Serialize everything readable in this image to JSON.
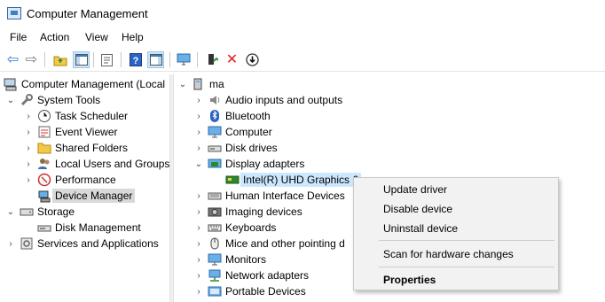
{
  "window": {
    "title": "Computer Management"
  },
  "menu": [
    "File",
    "Action",
    "View",
    "Help"
  ],
  "toolbar": {
    "buttons": [
      "back-icon",
      "forward-icon",
      "up-folder-icon",
      "show-hide-tree-icon",
      "properties-icon",
      "help-icon",
      "action-pane-icon",
      "monitor-icon",
      "update-driver-icon",
      "uninstall-icon",
      "download-icon"
    ]
  },
  "left_tree": {
    "root": "Computer Management (Local",
    "system_tools": "System Tools",
    "task_scheduler": "Task Scheduler",
    "event_viewer": "Event Viewer",
    "shared_folders": "Shared Folders",
    "local_users": "Local Users and Groups",
    "performance": "Performance",
    "device_manager": "Device Manager",
    "storage": "Storage",
    "disk_management": "Disk Management",
    "services": "Services and Applications"
  },
  "right_tree": {
    "computer_name": "ma",
    "audio": "Audio inputs and outputs",
    "bluetooth": "Bluetooth",
    "computer": "Computer",
    "disk_drives": "Disk drives",
    "display_adapters": "Display adapters",
    "intel_gpu": "Intel(R) UHD Graphics 6",
    "hid": "Human Interface Devices",
    "imaging": "Imaging devices",
    "keyboards": "Keyboards",
    "mice": "Mice and other pointing d",
    "monitors": "Monitors",
    "network": "Network adapters",
    "portable": "Portable Devices"
  },
  "context_menu": {
    "update_driver": "Update driver",
    "disable_device": "Disable device",
    "uninstall_device": "Uninstall device",
    "scan": "Scan for hardware changes",
    "properties": "Properties"
  }
}
